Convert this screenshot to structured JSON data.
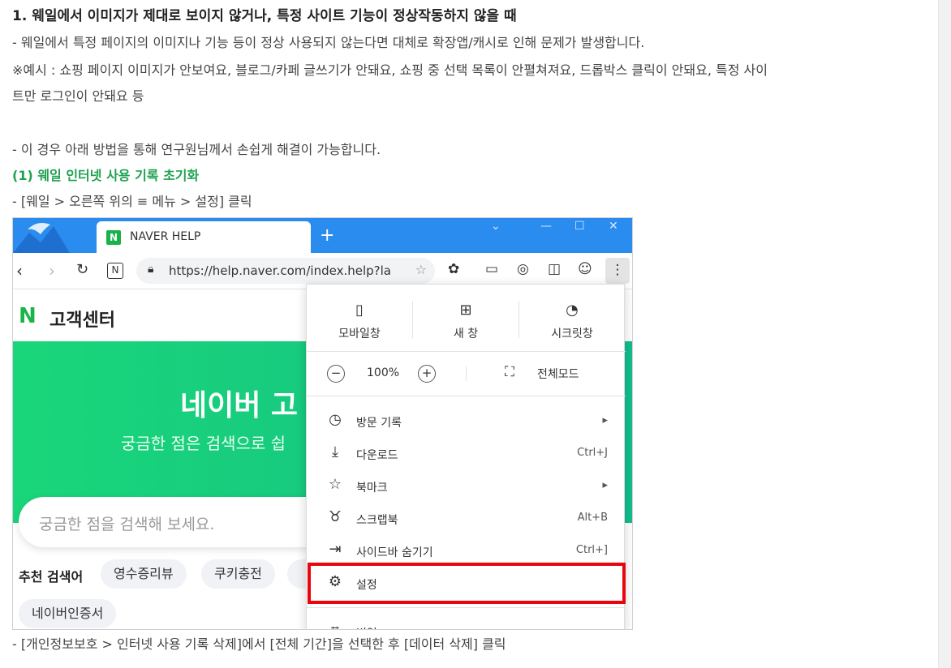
{
  "article": {
    "heading": "1. 웨일에서 이미지가 제대로 보이지 않거나, 특정 사이트 기능이 정상작동하지 않을 때",
    "p1": "- 웨일에서 특정 페이지의 이미지나 기능 등이 정상 사용되지 않는다면 대체로 확장앱/캐시로 인해 문제가 발생합니다.",
    "p2": "※예시 : 쇼핑 페이지 이미지가 안보여요, 블로그/카페 글쓰기가 안돼요, 쇼핑 중 선택 목록이 안펼쳐져요, 드롭박스 클릭이 안돼요, 특정 사이",
    "p3": "트만 로그인이 안돼요 등",
    "p4": "- 이 경우 아래 방법을 통해 연구원님께서 손쉽게 해결이 가능합니다.",
    "subheading": "(1) 웨일 인터넷 사용 기록 초기화",
    "p5": "- [웨일 > 오른쪽 위의 ≡ 메뉴 > 설정] 클릭",
    "p6": "- [개인정보보호 > 인터넷 사용 기록 삭제]에서 [전체 기간]을 선택한 후 [데이터 삭제] 클릭"
  },
  "browser": {
    "tab_icon": "N",
    "tab_title": "NAVER HELP",
    "new_tab": "+",
    "url": "https://help.naver.com/index.help?la",
    "reader_icon": "N"
  },
  "page": {
    "brand_icon": "N",
    "brand_name": "고객센터",
    "hero_title": "네이버 고",
    "hero_subtitle": "궁금한 점은 검색으로 쉽",
    "search_placeholder": "궁금한 점을 검색해 보세요.",
    "recommend_label": "추천 검색어",
    "chips": [
      "영수증리뷰",
      "쿠키충전",
      "네이버인증서"
    ]
  },
  "menu": {
    "mobile_window": "모바일창",
    "new_window": "새 창",
    "secret_window": "시크릿창",
    "zoom_minus": "−",
    "zoom_value": "100%",
    "zoom_plus": "+",
    "fullscreen": "전체모드",
    "items": [
      {
        "label": "방문 기록",
        "right": "▸"
      },
      {
        "label": "다운로드",
        "right": "Ctrl+J"
      },
      {
        "label": "북마크",
        "right": "▸"
      },
      {
        "label": "스크랩북",
        "right": "Alt+B"
      },
      {
        "label": "사이드바 숨기기",
        "right": "Ctrl+]"
      },
      {
        "label": "설정",
        "right": ""
      },
      {
        "label": "번역",
        "right": ""
      }
    ]
  },
  "colors": {
    "accent_green": "#1ea250",
    "highlight_red": "#e8050d",
    "titlebar_blue": "#2b8cf0"
  }
}
